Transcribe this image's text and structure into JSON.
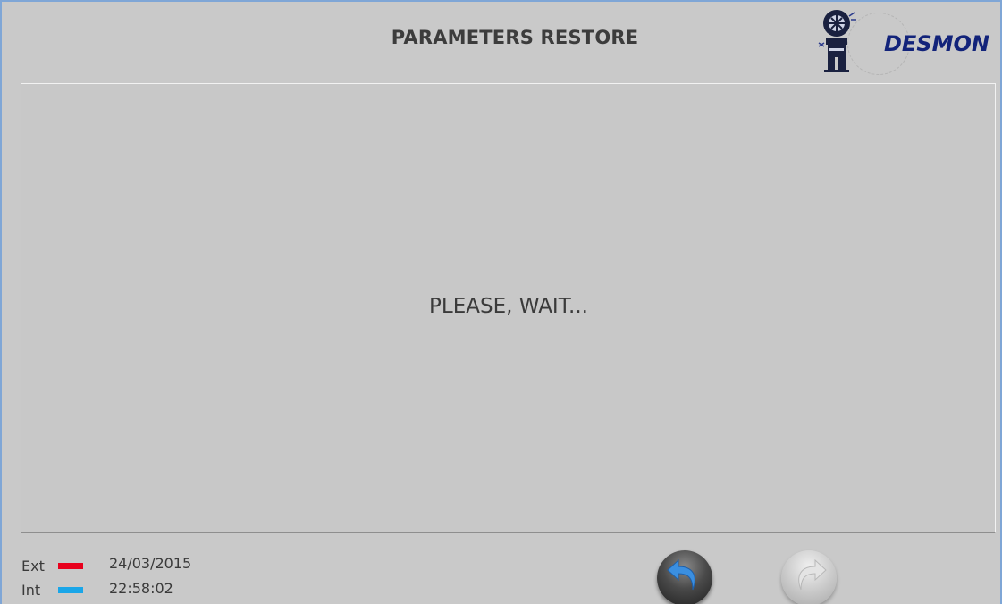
{
  "header": {
    "title": "PARAMETERS RESTORE",
    "logo_text": "DESMON"
  },
  "main": {
    "status_message": "PLEASE, WAIT..."
  },
  "footer": {
    "legend": [
      {
        "label": "Ext",
        "color": "#e8001c"
      },
      {
        "label": "Int",
        "color": "#1aa6e8"
      }
    ],
    "date": "24/03/2015",
    "time": "22:58:02",
    "back_button_icon": "back-arrow-icon",
    "forward_button_icon": "forward-arrow-icon"
  },
  "colors": {
    "background": "#c9c9c9",
    "logo_text": "#12237a",
    "back_arrow": "#3b8fe0"
  }
}
